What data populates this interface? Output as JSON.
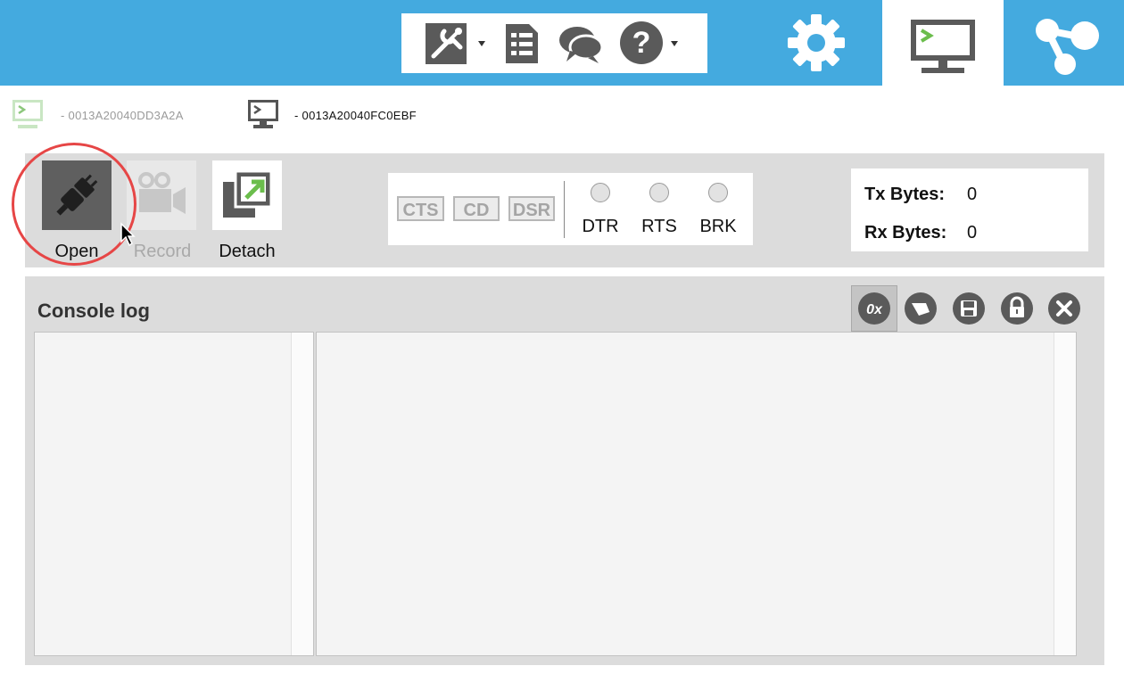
{
  "colors": {
    "topbar": "#44aadf",
    "highlight": "#e64646",
    "panel": "#dcdcdc"
  },
  "toolbar_icons": [
    "tools-icon",
    "document-list-icon",
    "chat-icon",
    "help-icon"
  ],
  "mode_tabs": [
    "configuration-mode",
    "consoles-mode",
    "network-mode"
  ],
  "devices": [
    {
      "id": "- 0013A20040DD3A2A",
      "state": "inactive"
    },
    {
      "id": "- 0013A20040FC0EBF",
      "state": "active"
    }
  ],
  "terminal": {
    "open_label": "Open",
    "record_label": "Record",
    "detach_label": "Detach",
    "lines_in": [
      "CTS",
      "CD",
      "DSR"
    ],
    "lines_out": [
      "DTR",
      "RTS",
      "BRK"
    ],
    "tx_label": "Tx Bytes:",
    "tx_value": "0",
    "rx_label": "Rx Bytes:",
    "rx_value": "0"
  },
  "console": {
    "title": "Console log",
    "hex_toggle_label": "0x"
  }
}
